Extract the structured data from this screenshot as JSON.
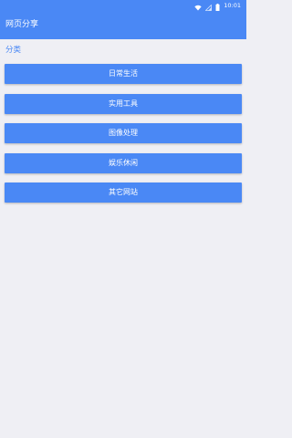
{
  "status_bar": {
    "time": "10:01",
    "icons": [
      "wifi-icon",
      "signal-icon",
      "battery-icon"
    ]
  },
  "app_bar": {
    "title": "网页分享"
  },
  "section": {
    "label": "分类"
  },
  "categories": [
    {
      "label": "日常生活"
    },
    {
      "label": "实用工具"
    },
    {
      "label": "图像处理"
    },
    {
      "label": "娱乐休闲"
    },
    {
      "label": "其它网站"
    }
  ],
  "colors": {
    "primary": "#4a88f5",
    "background": "#efeff4",
    "text_on_primary": "#ffffff"
  }
}
